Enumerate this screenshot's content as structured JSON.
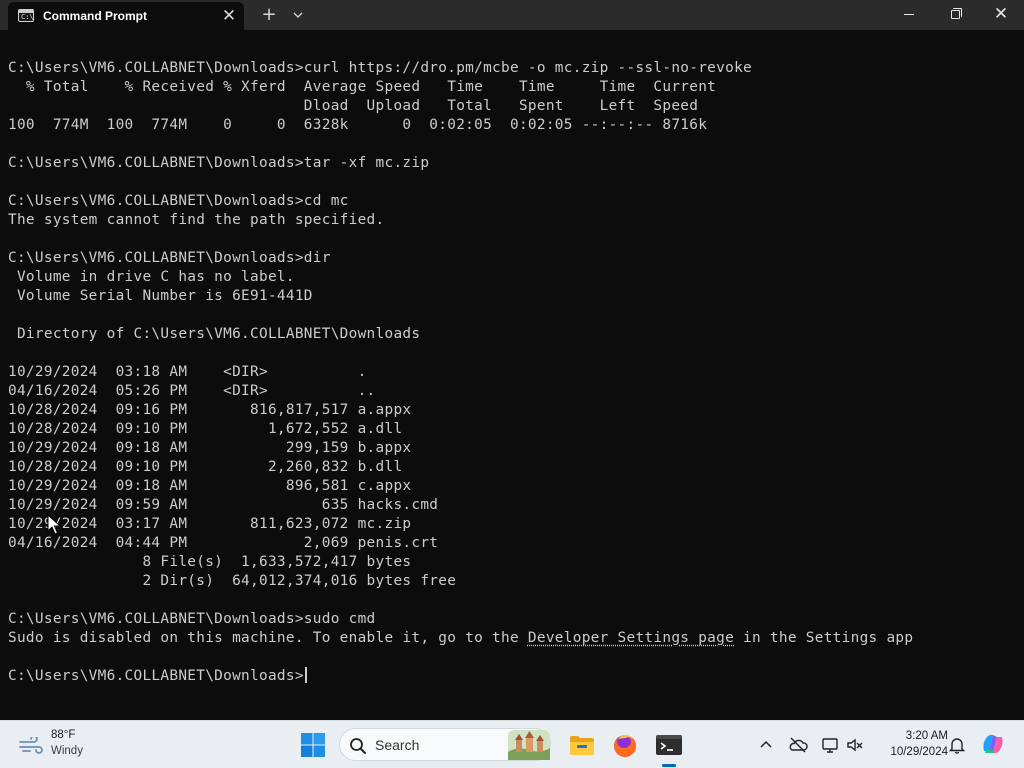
{
  "window": {
    "tab_title": "Command Prompt",
    "tab_icon_text": "C:\\",
    "tab_close": "✕",
    "new_tab": "+",
    "tab_dropdown": "⌄",
    "close_glyph": "✕"
  },
  "terminal": {
    "colors": {
      "background": "#0c0c0c",
      "foreground": "#cccccc"
    },
    "lines": [
      "C:\\Users\\VM6.COLLABNET\\Downloads>curl https://dro.pm/mcbe -o mc.zip --ssl-no-revoke",
      "  % Total    % Received % Xferd  Average Speed   Time    Time     Time  Current",
      "                                 Dload  Upload   Total   Spent    Left  Speed",
      "100  774M  100  774M    0     0  6328k      0  0:02:05  0:02:05 --:--:-- 8716k",
      "",
      "C:\\Users\\VM6.COLLABNET\\Downloads>tar -xf mc.zip",
      "",
      "C:\\Users\\VM6.COLLABNET\\Downloads>cd mc",
      "The system cannot find the path specified.",
      "",
      "C:\\Users\\VM6.COLLABNET\\Downloads>dir",
      " Volume in drive C has no label.",
      " Volume Serial Number is 6E91-441D",
      "",
      " Directory of C:\\Users\\VM6.COLLABNET\\Downloads",
      "",
      "10/29/2024  03:18 AM    <DIR>          .",
      "04/16/2024  05:26 PM    <DIR>          ..",
      "10/28/2024  09:16 PM       816,817,517 a.appx",
      "10/28/2024  09:10 PM         1,672,552 a.dll",
      "10/29/2024  09:18 AM           299,159 b.appx",
      "10/28/2024  09:10 PM         2,260,832 b.dll",
      "10/29/2024  09:18 AM           896,581 c.appx",
      "10/29/2024  09:59 AM               635 hacks.cmd",
      "10/29/2024  03:17 AM       811,623,072 mc.zip",
      "04/16/2024  04:44 PM             2,069 penis.crt",
      "               8 File(s)  1,633,572,417 bytes",
      "               2 Dir(s)  64,012,374,016 bytes free",
      "",
      "C:\\Users\\VM6.COLLABNET\\Downloads>sudo cmd"
    ],
    "sudo_message_before": "Sudo is disabled on this machine. To enable it, go to the ",
    "sudo_message_link": "Developer Settings page",
    "sudo_message_after": " in the Settings app",
    "prompt": "C:\\Users\\VM6.COLLABNET\\Downloads>"
  },
  "taskbar": {
    "weather": {
      "temperature": "88°F",
      "condition": "Windy",
      "icon": "wind-icon"
    },
    "search_label": "Search",
    "apps": [
      "start-icon",
      "file-explorer-icon",
      "firefox-icon",
      "terminal-icon"
    ],
    "tray_icons": [
      "chevron-up-icon",
      "onedrive-icon",
      "network-icon",
      "volume-muted-icon"
    ],
    "clock": {
      "time": "3:20 AM",
      "date": "10/29/2024"
    },
    "accent": "#0067c0"
  }
}
